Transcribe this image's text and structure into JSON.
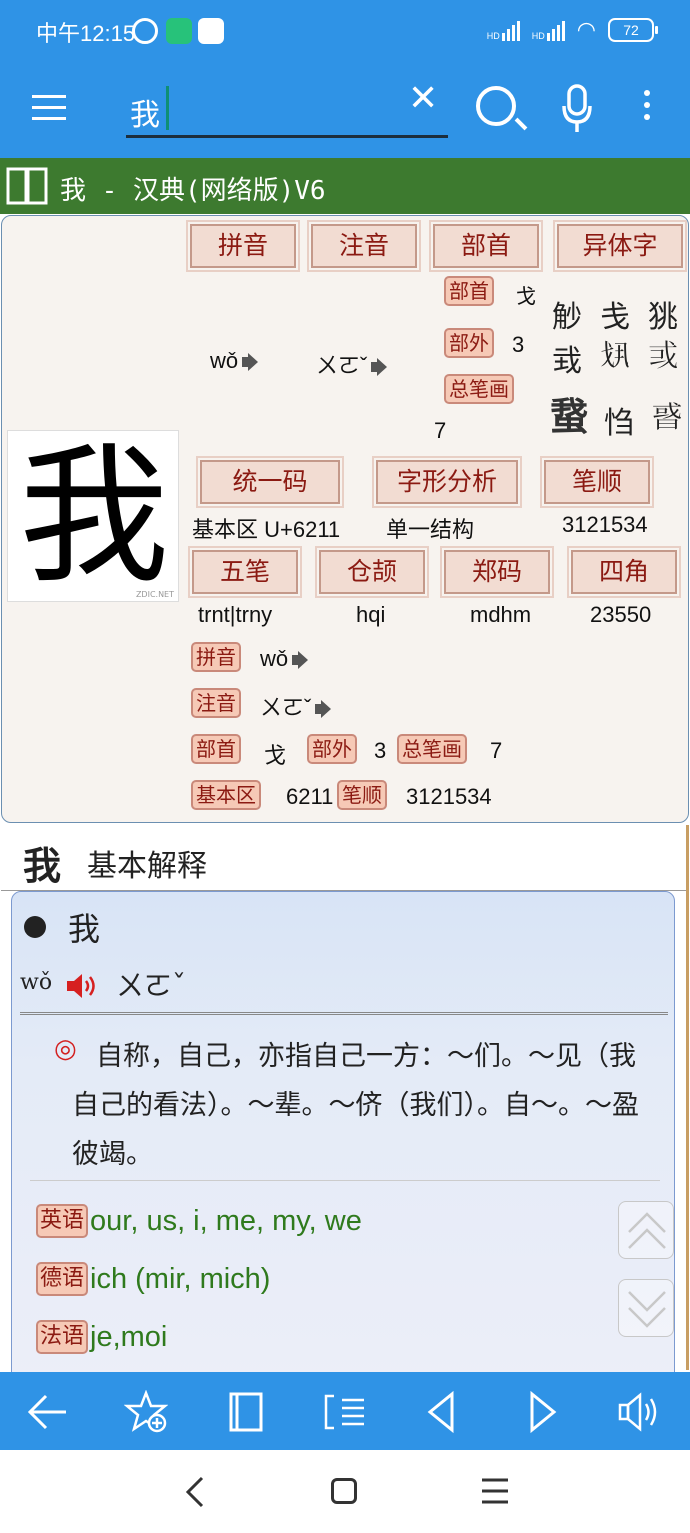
{
  "status": {
    "time": "中午12:15",
    "battery": "72",
    "hd1": "HD",
    "hd2": "HD"
  },
  "search": {
    "query": "我"
  },
  "title": "我 - 汉典(网络版)V6",
  "panel": {
    "headers": {
      "pinyin": "拼音",
      "zhuyin": "注音",
      "bushou": "部首",
      "yiti": "异体字",
      "unicode": "统一码",
      "zixing": "字形分析",
      "bishun": "笔顺",
      "wubi": "五笔",
      "cangjie": "仓颉",
      "zhengma": "郑码",
      "sijiao": "四角"
    },
    "pinyin": "wǒ",
    "zhuyin": "ㄨㄛˇ",
    "bushou_tag": "部首",
    "bushou_val": "戈",
    "buwai_tag": "部外",
    "buwai_val": "3",
    "zongbihua_tag": "总笔画",
    "zongbihua_val": "7",
    "variants": [
      "觘",
      "戋",
      "狣",
      "㦱",
      "𢦚",
      "𢦘",
      "䖸",
      "㤘",
      "𢧋"
    ],
    "unicode_val": "基本区 U+6211",
    "zixing_val": "单一结构",
    "bishun_val": "3121534",
    "wubi_val": "trnt|trny",
    "cangjie_val": "hqi",
    "zhengma_val": "mdhm",
    "sijiao_val": "23550",
    "big_char": "我",
    "watermark": "ZDIC.NET",
    "summary": {
      "pinyin_tag": "拼音",
      "pinyin_val": "wǒ",
      "zhuyin_tag": "注音",
      "zhuyin_val": "ㄨㄛˇ",
      "bushou_tag": "部首",
      "bushou_val": "戈",
      "buwai_tag": "部外",
      "buwai_val": "3",
      "zongbihua_tag": "总笔画",
      "zongbihua_val": "7",
      "jibenqu_tag": "基本区",
      "jibenqu_val": "6211",
      "bishun_tag": "笔顺",
      "bishun_val": "3121534"
    }
  },
  "basic": {
    "char": "我",
    "title": "基本解释",
    "entry_char": "我",
    "pinyin": "wǒ",
    "zhuyin": "ㄨㄛˇ",
    "def_mark": "◎",
    "definition": "自称，自己，亦指自己一方：～们。～见（我自己的看法）。～辈。～侪（我们）。自～。～盈彼竭。",
    "translations": [
      {
        "tag": "英语",
        "text": "our, us, i, me, my, we"
      },
      {
        "tag": "德语",
        "text": "ich (mir, mich)"
      },
      {
        "tag": "法语",
        "text": "je,moi"
      }
    ]
  },
  "colors": {
    "primary": "#2f93e6",
    "title_bar": "#3d7a2f",
    "tag_bg": "#f6c9b6",
    "tag_text": "#8b1a12",
    "translation": "#2f7a1d"
  }
}
